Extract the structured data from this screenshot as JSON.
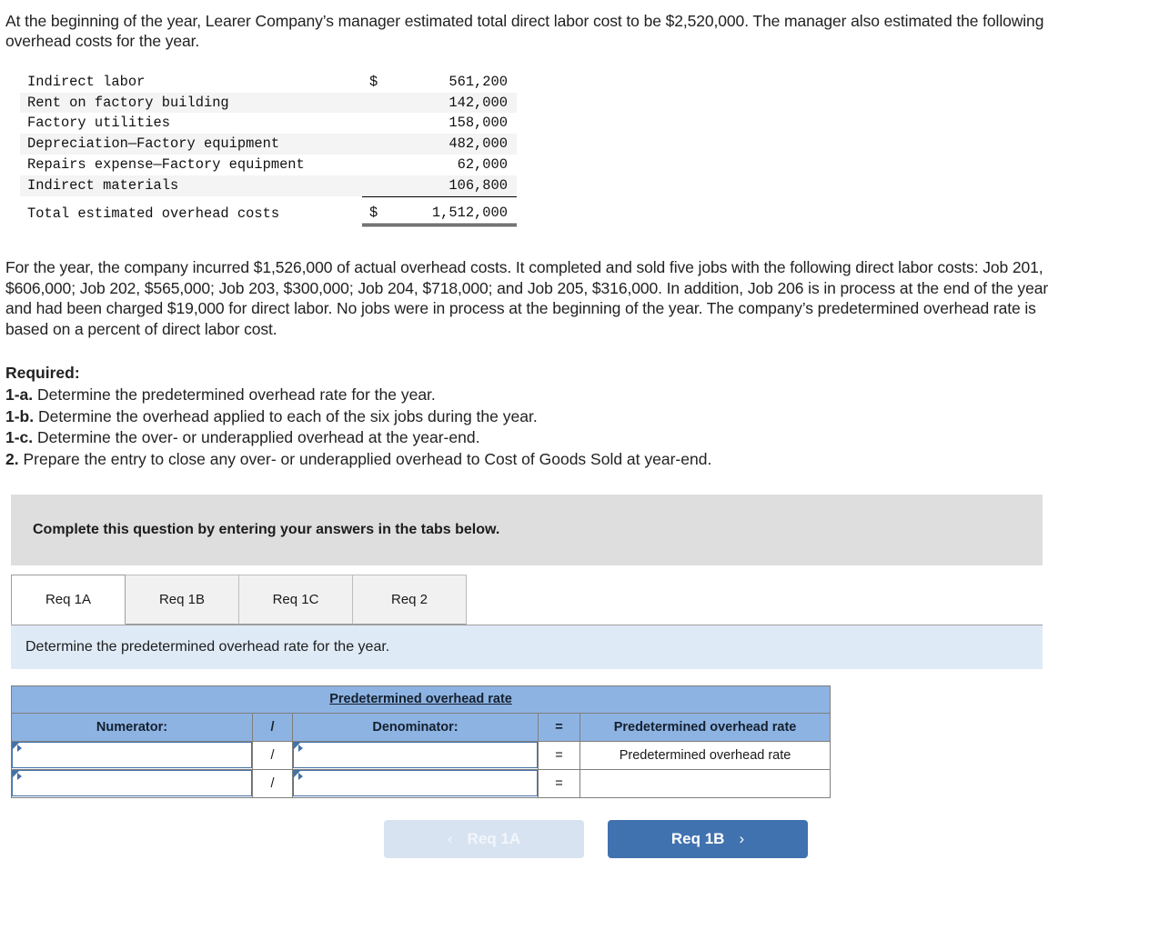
{
  "intro": {
    "paragraph1": "At the beginning of the year, Learer Company’s manager estimated total direct labor cost to be $2,520,000. The manager also estimated the following overhead costs for the year.",
    "paragraph2": "For the year, the company incurred $1,526,000 of actual overhead costs. It completed and sold five jobs with the following direct labor costs: Job 201, $606,000; Job 202, $565,000; Job 203, $300,000; Job 204, $718,000; and Job 205, $316,000. In addition, Job 206 is in process at the end of the year and had been charged $19,000 for direct labor. No jobs were in process at the beginning of the year. The company’s predetermined overhead rate is based on a percent of direct labor cost."
  },
  "cost_table": {
    "rows": [
      {
        "label": "Indirect labor",
        "symbol": "$",
        "amount": "561,200"
      },
      {
        "label": "Rent on factory building",
        "symbol": "",
        "amount": "142,000"
      },
      {
        "label": "Factory utilities",
        "symbol": "",
        "amount": "158,000"
      },
      {
        "label": "Depreciation—Factory equipment",
        "symbol": "",
        "amount": "482,000"
      },
      {
        "label": "Repairs expense—Factory equipment",
        "symbol": "",
        "amount": "62,000"
      },
      {
        "label": "Indirect materials",
        "symbol": "",
        "amount": "106,800"
      }
    ],
    "total": {
      "label": "Total estimated overhead costs",
      "symbol": "$",
      "amount": "1,512,000"
    }
  },
  "required": {
    "heading": "Required:",
    "items": [
      {
        "label": "1-a.",
        "text": "Determine the predetermined overhead rate for the year."
      },
      {
        "label": "1-b.",
        "text": "Determine the overhead applied to each of the six jobs during the year."
      },
      {
        "label": "1-c.",
        "text": "Determine the over- or underapplied overhead at the year-end."
      },
      {
        "label": "2.",
        "text": "Prepare the entry to close any over- or underapplied overhead to Cost of Goods Sold at year-end."
      }
    ]
  },
  "banner": {
    "text": "Complete this question by entering your answers in the tabs below."
  },
  "tabs": [
    {
      "label": "Req 1A",
      "active": true
    },
    {
      "label": "Req 1B",
      "active": false
    },
    {
      "label": "Req 1C",
      "active": false
    },
    {
      "label": "Req 2",
      "active": false
    }
  ],
  "sub_instruction": {
    "text": "Determine the predetermined overhead rate for the year."
  },
  "answer_table": {
    "title": "Predetermined overhead rate",
    "headers": {
      "numerator": "Numerator:",
      "slash": "/",
      "denominator": "Denominator:",
      "equals": "=",
      "result": "Predetermined overhead rate"
    },
    "rows": [
      {
        "numerator_value": "",
        "slash": "/",
        "denominator_value": "",
        "equals": "=",
        "result": "Predetermined overhead rate"
      },
      {
        "numerator_value": "",
        "slash": "/",
        "denominator_value": "",
        "equals": "=",
        "result": ""
      }
    ]
  },
  "nav": {
    "prev_label": "Req 1A",
    "prev_chevron": "‹",
    "next_label": "Req 1B",
    "next_chevron": "›"
  },
  "colors": {
    "header_blue": "#8db3e2",
    "instruction_blue": "#dfeaf7",
    "banner_gray": "#dedede",
    "button_blue": "#4172b0",
    "button_disabled": "#d7e3f1",
    "input_border": "#4472a8"
  }
}
